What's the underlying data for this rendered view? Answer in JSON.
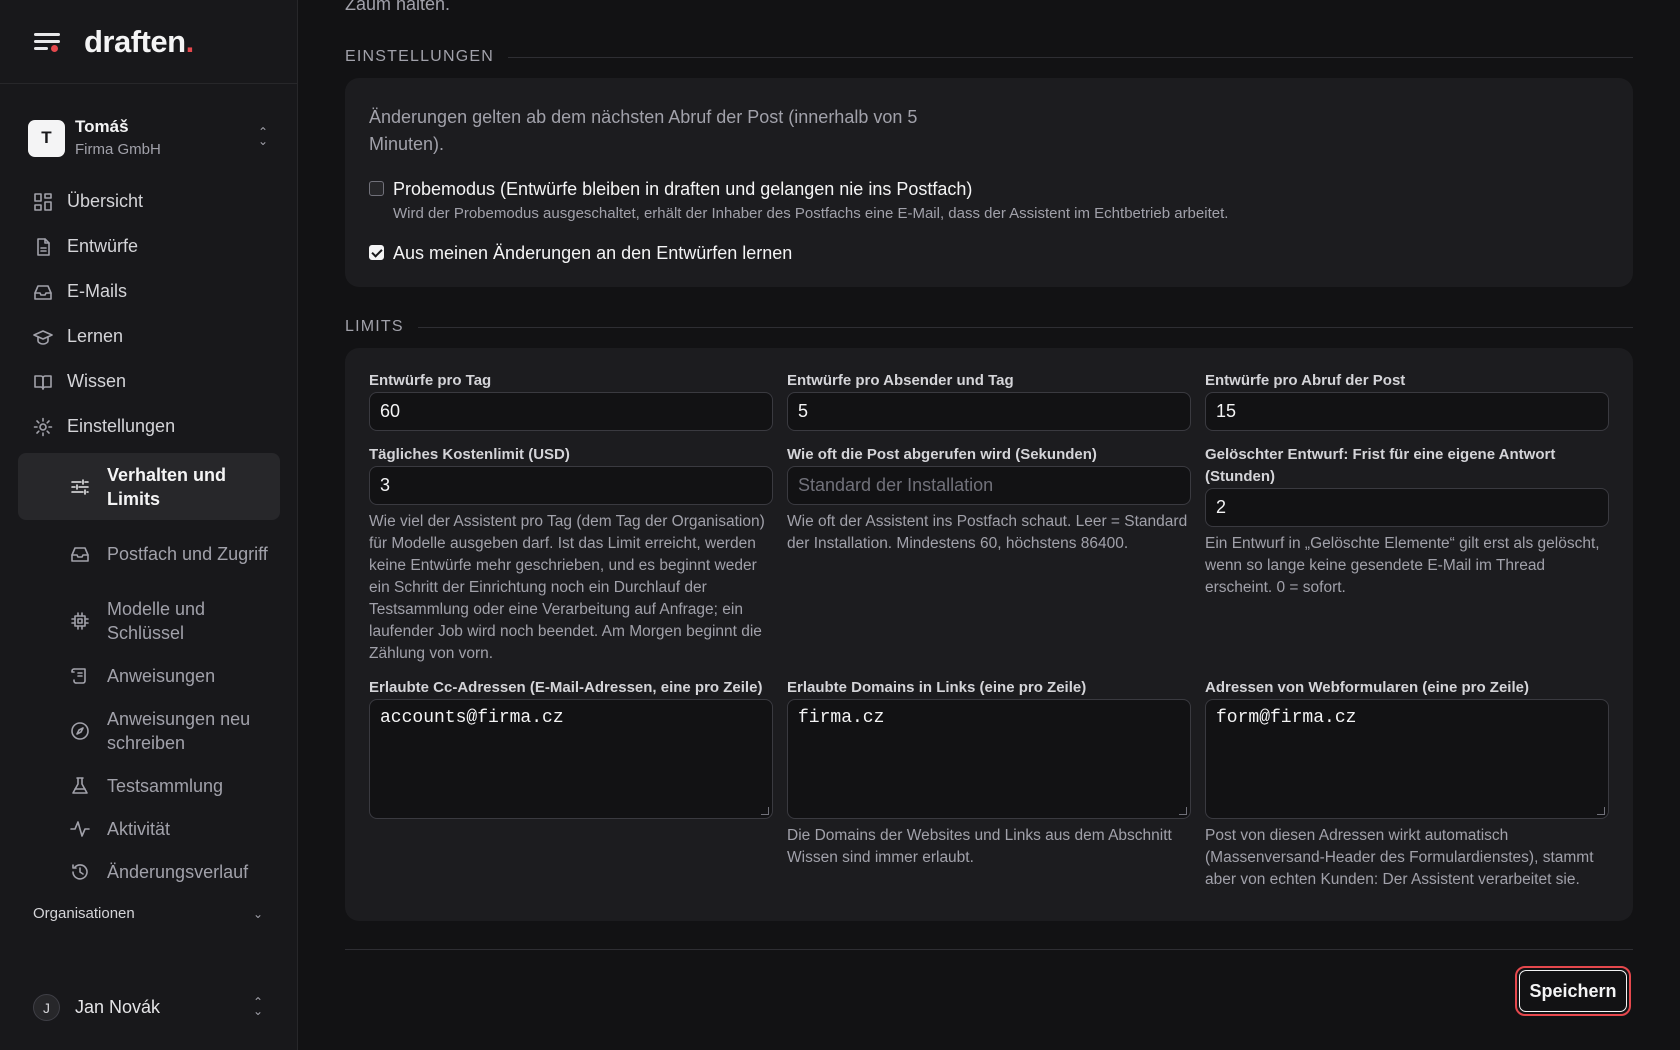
{
  "brand": {
    "name": "draften",
    "dot": "."
  },
  "account": {
    "initial": "T",
    "name": "Tomáš",
    "org": "Firma GmbH"
  },
  "nav": {
    "overview": "Übersicht",
    "drafts": "Entwürfe",
    "emails": "E-Mails",
    "learning": "Lernen",
    "knowledge": "Wissen",
    "settings": "Einstellungen"
  },
  "subnav": {
    "behavior": "Verhalten und Limits",
    "mailbox": "Postfach und Zugriff",
    "models": "Modelle und Schlüssel",
    "instructions": "Anweisungen",
    "rewrite": "Anweisungen neu schreiben",
    "testsuite": "Testsammlung",
    "activity": "Aktivität",
    "history": "Änderungsverlauf"
  },
  "organizations": "Organisationen",
  "user": {
    "initial": "J",
    "name": "Jan Novák"
  },
  "main": {
    "intro_tail": "Zaum halten.",
    "settings_heading": "EINSTELLUNGEN",
    "settings_note": "Änderungen gelten ab dem nächsten Abruf der Post (innerhalb von 5 Minuten).",
    "test_mode": {
      "label": "Probemodus (Entwürfe bleiben in draften und gelangen nie ins Postfach)",
      "help": "Wird der Probemodus ausgeschaltet, erhält der Inhaber des Postfachs eine E-Mail, dass der Assistent im Echtbetrieb arbeitet.",
      "checked": false
    },
    "learn": {
      "label": "Aus meinen Änderungen an den Entwürfen lernen",
      "checked": true
    },
    "limits_heading": "LIMITS",
    "limits": {
      "per_day": {
        "label": "Entwürfe pro Tag",
        "value": "60"
      },
      "per_sender": {
        "label": "Entwürfe pro Absender und Tag",
        "value": "5"
      },
      "per_fetch": {
        "label": "Entwürfe pro Abruf der Post",
        "value": "15"
      },
      "cost": {
        "label": "Tägliches Kostenlimit (USD)",
        "value": "3",
        "help": "Wie viel der Assistent pro Tag (dem Tag der Organisation) für Modelle ausgeben darf. Ist das Limit erreicht, werden keine Entwürfe mehr geschrieben, und es beginnt weder ein Schritt der Einrichtung noch ein Durchlauf der Testsammlung oder eine Verarbeitung auf Anfrage; ein laufender Job wird noch beendet. Am Morgen beginnt die Zählung von vorn."
      },
      "interval": {
        "label": "Wie oft die Post abgerufen wird (Sekunden)",
        "placeholder": "Standard der Installation",
        "help": "Wie oft der Assistent ins Postfach schaut. Leer = Standard der Installation. Mindestens 60, höchstens 86400."
      },
      "deleted": {
        "label": "Gelöschter Entwurf: Frist für eine eigene Antwort (Stunden)",
        "value": "2",
        "help": "Ein Entwurf in „Gelöschte Elemente“ gilt erst als gelöscht, wenn so lange keine gesendete E-Mail im Thread erscheint. 0 = sofort."
      },
      "cc": {
        "label": "Erlaubte Cc-Adressen (E-Mail-Adressen, eine pro Zeile)",
        "value": "accounts@firma.cz"
      },
      "domains": {
        "label": "Erlaubte Domains in Links (eine pro Zeile)",
        "value": "firma.cz",
        "help": "Die Domains der Websites und Links aus dem Abschnitt Wissen sind immer erlaubt."
      },
      "webforms": {
        "label": "Adressen von Webformularen (eine pro Zeile)",
        "value": "form@firma.cz",
        "help": "Post von diesen Adressen wirkt automatisch (Massenversand-Header des Formulardienstes), stammt aber von echten Kunden: Der Assistent verarbeitet sie."
      }
    },
    "save_label": "Speichern"
  },
  "colors": {
    "accent": "#e5484d",
    "background": "#121214",
    "sidebar": "#18181b",
    "card": "#1c1c1f"
  }
}
